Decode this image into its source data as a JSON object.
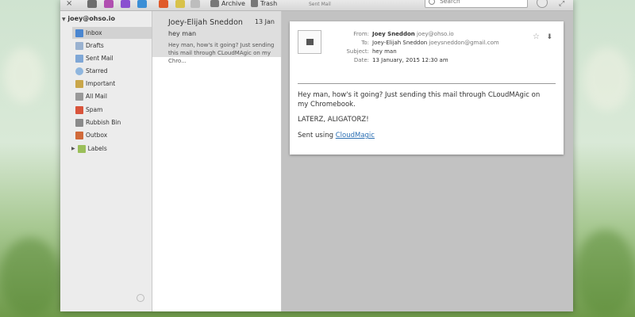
{
  "toolbar": {
    "archive_label": "Archive",
    "trash_label": "Trash",
    "folder_title": "Sent Mail",
    "search_placeholder": "Search",
    "close_glyph": "×"
  },
  "sidebar": {
    "account": "joey@ohso.io",
    "folders": [
      {
        "label": "Inbox"
      },
      {
        "label": "Drafts"
      },
      {
        "label": "Sent Mail"
      },
      {
        "label": "Starred"
      },
      {
        "label": "Important"
      },
      {
        "label": "All Mail"
      },
      {
        "label": "Spam"
      },
      {
        "label": "Rubbish Bin"
      },
      {
        "label": "Outbox"
      },
      {
        "label": "Labels"
      }
    ]
  },
  "message_list": {
    "items": [
      {
        "sender": "Joey-Elijah Sneddon",
        "date": "13 Jan",
        "subject": "hey man",
        "preview": "Hey man, how's it going? Just sending this mail through CLoudMAgic on my Chro..."
      }
    ]
  },
  "reader": {
    "from_label": "From:",
    "from_name": "Joey Sneddon",
    "from_email": "joey@ohso.io",
    "to_label": "To:",
    "to_name": "Joey-Elijah Sneddon",
    "to_email": "joeysneddon@gmail.com",
    "subject_label": "Subject:",
    "subject": "hey man",
    "date_label": "Date:",
    "date": "13 January, 2015 12:30 am",
    "body_line1": "Hey man, how's it going? Just sending this mail through CLoudMAgic on my Chromebook.",
    "body_line2": "LATERZ, ALIGATORZ!",
    "signature_prefix": "Sent using ",
    "signature_link": "CloudMagic"
  },
  "colors": {
    "accent": "#2b6fb3",
    "selected_row": "#dedede",
    "reader_bg": "#c2c2c2"
  }
}
